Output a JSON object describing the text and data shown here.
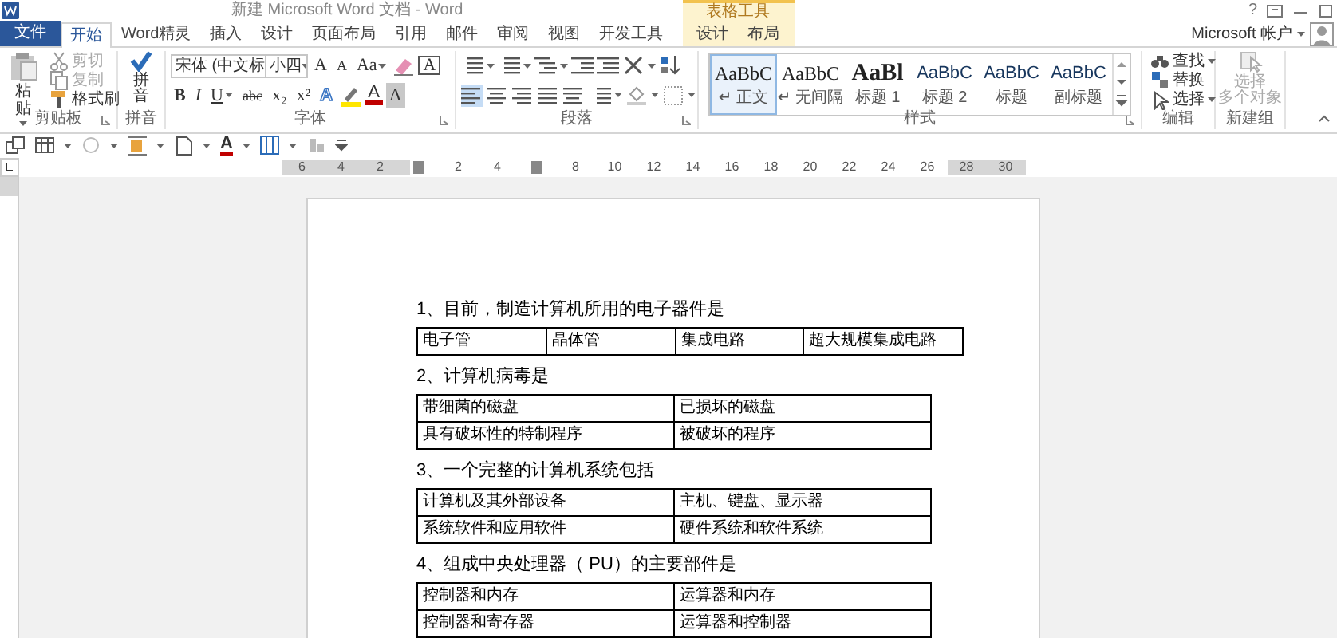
{
  "window": {
    "title": "新建 Microsoft Word 文档 - Word",
    "help": "?",
    "contextual_group": "表格工具",
    "account": "Microsoft 帐户"
  },
  "tabs": [
    {
      "label": "文件",
      "kind": "file",
      "selected": false
    },
    {
      "label": "开始",
      "kind": "normal",
      "selected": true
    },
    {
      "label": "Word精灵",
      "kind": "normal",
      "selected": false
    },
    {
      "label": "插入",
      "kind": "normal",
      "selected": false
    },
    {
      "label": "设计",
      "kind": "normal",
      "selected": false
    },
    {
      "label": "页面布局",
      "kind": "normal",
      "selected": false
    },
    {
      "label": "引用",
      "kind": "normal",
      "selected": false
    },
    {
      "label": "邮件",
      "kind": "normal",
      "selected": false
    },
    {
      "label": "审阅",
      "kind": "normal",
      "selected": false
    },
    {
      "label": "视图",
      "kind": "normal",
      "selected": false
    },
    {
      "label": "开发工具",
      "kind": "normal",
      "selected": false
    },
    {
      "label": "设计",
      "kind": "contextual",
      "selected": false
    },
    {
      "label": "布局",
      "kind": "contextual",
      "selected": false
    }
  ],
  "ribbon": {
    "clipboard": {
      "group": "剪贴板",
      "paste": "粘贴",
      "items": [
        {
          "label": "剪切",
          "disabled": true
        },
        {
          "label": "复制",
          "disabled": true
        },
        {
          "label": "格式刷",
          "disabled": false
        }
      ]
    },
    "pinyin": {
      "group": "拼音",
      "button": "拼音"
    },
    "font": {
      "group": "字体",
      "face": "宋体 (中文标",
      "size": "小四",
      "grow": "A",
      "shrink": "A",
      "case": "Aa",
      "border": "A",
      "bold": "B",
      "italic": "I",
      "underline": "U",
      "strike": "abc",
      "sub": "x₂",
      "sup": "x²",
      "effects": "A",
      "font_color": "A",
      "shading": "A"
    },
    "paragraph": {
      "group": "段落",
      "align": [
        {
          "selected": true
        },
        {
          "selected": false
        },
        {
          "selected": false
        },
        {
          "selected": false
        },
        {
          "selected": false
        }
      ]
    },
    "styles": {
      "group": "样式",
      "items": [
        {
          "preview": "AaBbC",
          "name": "↵ 正文",
          "kind": "serif",
          "selected": true
        },
        {
          "preview": "AaBbC",
          "name": "↵ 无间隔",
          "kind": "serif",
          "selected": false
        },
        {
          "preview": "AaBl",
          "name": "标题 1",
          "kind": "heading",
          "selected": false
        },
        {
          "preview": "AaBbC",
          "name": "标题 2",
          "kind": "sans",
          "selected": false
        },
        {
          "preview": "AaBbC",
          "name": "标题",
          "kind": "sans",
          "selected": false
        },
        {
          "preview": "AaBbC",
          "name": "副标题",
          "kind": "sans",
          "selected": false
        }
      ]
    },
    "editing": {
      "group": "编辑",
      "find": "查找",
      "replace": "替换",
      "select": "选择"
    },
    "new_group": {
      "group": "新建组",
      "lines": [
        "选择",
        "多个对象"
      ],
      "disabled": true
    }
  },
  "quick_toolbar": {
    "font_color": "A"
  },
  "ruler": [
    {
      "kind": "number",
      "label": "6"
    },
    {
      "kind": "number",
      "label": "4"
    },
    {
      "kind": "number",
      "label": "2"
    },
    {
      "kind": "marker"
    },
    {
      "kind": "number",
      "label": "2"
    },
    {
      "kind": "number",
      "label": "4"
    },
    {
      "kind": "marker"
    },
    {
      "kind": "number",
      "label": "8"
    },
    {
      "kind": "number",
      "label": "10"
    },
    {
      "kind": "number",
      "label": "12"
    },
    {
      "kind": "number",
      "label": "14"
    },
    {
      "kind": "number",
      "label": "16"
    },
    {
      "kind": "number",
      "label": "18"
    },
    {
      "kind": "number",
      "label": "20"
    },
    {
      "kind": "number",
      "label": "22"
    },
    {
      "kind": "number",
      "label": "24"
    },
    {
      "kind": "number",
      "label": "26"
    },
    {
      "kind": "number",
      "label": "28"
    },
    {
      "kind": "number",
      "label": "30"
    }
  ],
  "document": [
    {
      "question": "1、目前，制造计算机所用的电子器件是",
      "rows": [
        [
          "电子管",
          "晶体管",
          "集成电路",
          "超大规模集成电路"
        ]
      ]
    },
    {
      "question": "2、计算机病毒是",
      "rows": [
        [
          "带细菌的磁盘",
          "已损坏的磁盘"
        ],
        [
          "具有破坏性的特制程序",
          "被破坏的程序"
        ]
      ]
    },
    {
      "question": "3、一个完整的计算机系统包括",
      "rows": [
        [
          "计算机及其外部设备",
          "主机、键盘、显示器"
        ],
        [
          "系统软件和应用软件",
          "硬件系统和软件系统"
        ]
      ]
    },
    {
      "question": "4、组成中央处理器（ PU）的主要部件是",
      "rows": [
        [
          "控制器和内存",
          "运算器和内存"
        ],
        [
          "控制器和寄存器",
          "运算器和控制器"
        ]
      ]
    }
  ]
}
